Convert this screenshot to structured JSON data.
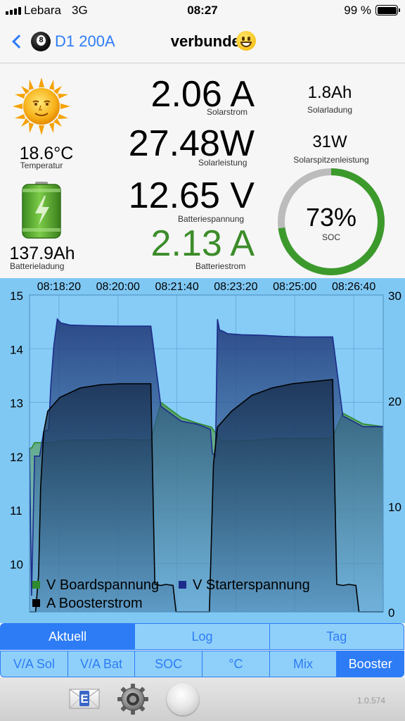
{
  "status_bar": {
    "carrier": "Lebara",
    "network": "3G",
    "time": "08:27",
    "battery_percent": "99 %"
  },
  "navbar": {
    "back_label": "D1 200A",
    "title": "verbunden"
  },
  "readings": {
    "temperature": {
      "value": "18.6°C",
      "label": "Temperatur"
    },
    "battery_charge": {
      "value": "137.9Ah",
      "label": "Batterieladung"
    },
    "solar_current": {
      "value": "2.06 A",
      "label": "Solarstrom"
    },
    "solar_power": {
      "value": "27.48W",
      "label": "Solarleistung"
    },
    "battery_voltage": {
      "value": "12.65 V",
      "label": "Batteriespannung"
    },
    "battery_current": {
      "value": "2.13 A",
      "label": "Batteriestrom"
    },
    "solar_charge": {
      "value": "1.8Ah",
      "label": "Solarladung"
    },
    "solar_peak_power": {
      "value": "31W",
      "label": "Solarspitzenleistung"
    },
    "soc": {
      "value": "73%",
      "label": "SOC",
      "fraction": 0.73
    }
  },
  "colors": {
    "accent": "#2d7cf6",
    "positive_green": "#3c8c2a",
    "soc_ring": "#3c9a2c",
    "soc_track": "#bcbcbc",
    "chart_bg": "#80c8f4"
  },
  "chart_data": {
    "type": "area",
    "x_tick_labels": [
      "08:18:20",
      "08:20:00",
      "08:21:40",
      "08:23:20",
      "08:25:00",
      "08:26:40"
    ],
    "y_left_ticks": [
      "15",
      "14",
      "13",
      "12",
      "11",
      "10"
    ],
    "y_right_ticks": [
      "30",
      "20",
      "10",
      "0"
    ],
    "ylim_left": [
      9.1,
      15
    ],
    "ylim_right": [
      0,
      30
    ],
    "xlim": [
      0,
      700
    ],
    "grid": true,
    "legend_position": "bottom-left",
    "series": [
      {
        "name": "V Boardspannung",
        "axis": "left",
        "color": "#2f8a2f",
        "x": [
          0,
          4,
          10,
          20,
          40,
          60,
          80,
          100,
          140,
          180,
          220,
          240,
          260,
          300,
          330,
          345,
          360,
          380,
          410,
          450,
          490,
          540,
          580,
          600,
          620,
          660,
          700
        ],
        "y": [
          12.15,
          12.15,
          12.25,
          12.25,
          12.25,
          12.28,
          12.3,
          12.3,
          12.3,
          12.31,
          12.3,
          12.3,
          13.0,
          12.72,
          12.62,
          12.58,
          12.54,
          12.28,
          12.28,
          12.3,
          12.33,
          12.33,
          12.33,
          12.35,
          12.8,
          12.6,
          12.55
        ]
      },
      {
        "name": "V Starterspannung",
        "axis": "left",
        "color": "#1c2c8a",
        "x": [
          0,
          4,
          10,
          20,
          28,
          38,
          42,
          48,
          55,
          62,
          80,
          120,
          180,
          240,
          260,
          300,
          330,
          345,
          358,
          362,
          368,
          372,
          376,
          384,
          392,
          420,
          460,
          500,
          540,
          600,
          620,
          660,
          700
        ],
        "y": [
          12.15,
          9.4,
          12.0,
          12.0,
          12.45,
          12.5,
          13.3,
          14.05,
          14.55,
          14.48,
          14.44,
          14.43,
          14.42,
          14.42,
          12.93,
          12.65,
          12.6,
          12.55,
          12.5,
          12.05,
          12.0,
          14.55,
          14.35,
          14.32,
          14.28,
          14.26,
          14.25,
          14.23,
          14.22,
          14.22,
          12.75,
          12.55,
          12.55
        ]
      },
      {
        "name": "A Boosterstrom",
        "axis": "right",
        "color": "#000000",
        "x": [
          0,
          12,
          18,
          22,
          28,
          36,
          60,
          100,
          140,
          180,
          240,
          248,
          260,
          270,
          284,
          290,
          300,
          356,
          364,
          372,
          400,
          440,
          480,
          520,
          560,
          600,
          608,
          620,
          632,
          646,
          652,
          700
        ],
        "y": [
          0,
          0,
          3.5,
          11.8,
          17.0,
          19.0,
          20.3,
          21.2,
          21.5,
          21.6,
          21.6,
          2.6,
          2.5,
          2.6,
          2.5,
          0,
          0,
          0,
          14.0,
          17.5,
          19.0,
          20.5,
          21.2,
          21.6,
          21.8,
          22.0,
          2.6,
          2.5,
          2.6,
          2.5,
          0,
          0
        ]
      }
    ]
  },
  "tabs_row1": [
    {
      "label": "Aktuell",
      "active": true
    },
    {
      "label": "Log",
      "active": false
    },
    {
      "label": "Tag",
      "active": false
    }
  ],
  "tabs_row2": [
    {
      "label": "V/A Sol",
      "active": false
    },
    {
      "label": "V/A Bat",
      "active": false
    },
    {
      "label": "SOC",
      "active": false
    },
    {
      "label": "°C",
      "active": false
    },
    {
      "label": "Mix",
      "active": false
    },
    {
      "label": "Booster",
      "active": true
    }
  ],
  "toolbar": {
    "version": "1.0.574",
    "mail_icon": "mail-e-icon",
    "settings_icon": "gear-icon",
    "round_button": "round-button"
  }
}
